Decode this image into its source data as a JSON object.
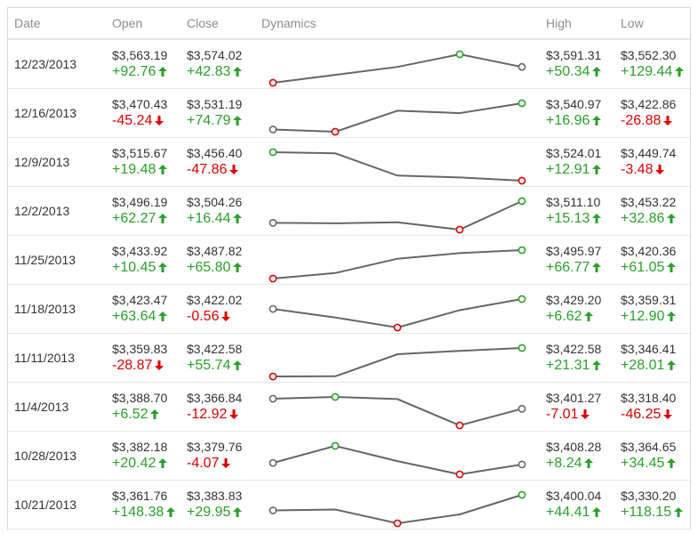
{
  "columns": [
    "Date",
    "Open",
    "Close",
    "Dynamics",
    "High",
    "Low"
  ],
  "colors": {
    "up": "#2aa12a",
    "down": "#e00000",
    "line": "#666666"
  },
  "rows": [
    {
      "date": "12/23/2013",
      "open": {
        "price": "$3,563.19",
        "change": "+92.76",
        "dir": "up"
      },
      "close": {
        "price": "$3,574.02",
        "change": "+42.83",
        "dir": "up"
      },
      "high": {
        "price": "$3,591.31",
        "change": "+50.34",
        "dir": "up"
      },
      "low": {
        "price": "$3,552.30",
        "change": "+129.44",
        "dir": "up"
      },
      "dynamics": [
        3552.3,
        3563.19,
        3574.02,
        3591.31,
        3574.02
      ]
    },
    {
      "date": "12/16/2013",
      "open": {
        "price": "$3,470.43",
        "change": "-45.24",
        "dir": "down"
      },
      "close": {
        "price": "$3,531.19",
        "change": "+74.79",
        "dir": "up"
      },
      "high": {
        "price": "$3,540.97",
        "change": "+16.96",
        "dir": "up"
      },
      "low": {
        "price": "$3,422.86",
        "change": "-26.88",
        "dir": "down"
      },
      "dynamics": [
        3432,
        3422.86,
        3510,
        3500,
        3540.97
      ]
    },
    {
      "date": "12/9/2013",
      "open": {
        "price": "$3,515.67",
        "change": "+19.48",
        "dir": "up"
      },
      "close": {
        "price": "$3,456.40",
        "change": "-47.86",
        "dir": "down"
      },
      "high": {
        "price": "$3,524.01",
        "change": "+12.91",
        "dir": "up"
      },
      "low": {
        "price": "$3,449.74",
        "change": "-3.48",
        "dir": "down"
      },
      "dynamics": [
        3524.01,
        3521,
        3463,
        3458,
        3449.74
      ]
    },
    {
      "date": "12/2/2013",
      "open": {
        "price": "$3,496.19",
        "change": "+62.27",
        "dir": "up"
      },
      "close": {
        "price": "$3,504.26",
        "change": "+16.44",
        "dir": "up"
      },
      "high": {
        "price": "$3,511.10",
        "change": "+15.13",
        "dir": "up"
      },
      "low": {
        "price": "$3,453.22",
        "change": "+32.86",
        "dir": "up"
      },
      "dynamics": [
        3467,
        3466,
        3468,
        3453.22,
        3511.1
      ]
    },
    {
      "date": "11/25/2013",
      "open": {
        "price": "$3,433.92",
        "change": "+10.45",
        "dir": "up"
      },
      "close": {
        "price": "$3,487.82",
        "change": "+65.80",
        "dir": "up"
      },
      "high": {
        "price": "$3,495.97",
        "change": "+66.77",
        "dir": "up"
      },
      "low": {
        "price": "$3,420.36",
        "change": "+61.05",
        "dir": "up"
      },
      "dynamics": [
        3420.36,
        3435,
        3473,
        3488,
        3495.97
      ]
    },
    {
      "date": "11/18/2013",
      "open": {
        "price": "$3,423.47",
        "change": "+63.64",
        "dir": "up"
      },
      "close": {
        "price": "$3,422.02",
        "change": "-0.56",
        "dir": "down"
      },
      "high": {
        "price": "$3,429.20",
        "change": "+6.62",
        "dir": "up"
      },
      "low": {
        "price": "$3,359.31",
        "change": "+12.90",
        "dir": "up"
      },
      "dynamics": [
        3405,
        3384,
        3359.31,
        3402,
        3429.2
      ]
    },
    {
      "date": "11/11/2013",
      "open": {
        "price": "$3,359.83",
        "change": "-28.87",
        "dir": "down"
      },
      "close": {
        "price": "$3,422.58",
        "change": "+55.74",
        "dir": "up"
      },
      "high": {
        "price": "$3,422.58",
        "change": "+21.31",
        "dir": "up"
      },
      "low": {
        "price": "$3,346.41",
        "change": "+28.01",
        "dir": "up"
      },
      "dynamics": [
        3346.41,
        3347,
        3406,
        3415,
        3422.58
      ]
    },
    {
      "date": "11/4/2013",
      "open": {
        "price": "$3,388.70",
        "change": "+6.52",
        "dir": "up"
      },
      "close": {
        "price": "$3,366.84",
        "change": "-12.92",
        "dir": "down"
      },
      "high": {
        "price": "$3,401.27",
        "change": "-7.01",
        "dir": "down"
      },
      "low": {
        "price": "$3,318.40",
        "change": "-46.25",
        "dir": "down"
      },
      "dynamics": [
        3396,
        3401.27,
        3395,
        3318.4,
        3366.84
      ]
    },
    {
      "date": "10/28/2013",
      "open": {
        "price": "$3,382.18",
        "change": "+20.42",
        "dir": "up"
      },
      "close": {
        "price": "$3,379.76",
        "change": "-4.07",
        "dir": "down"
      },
      "high": {
        "price": "$3,408.28",
        "change": "+8.24",
        "dir": "up"
      },
      "low": {
        "price": "$3,364.65",
        "change": "+34.45",
        "dir": "up"
      },
      "dynamics": [
        3382.18,
        3408.28,
        3385,
        3364.65,
        3379.76
      ]
    },
    {
      "date": "10/21/2013",
      "open": {
        "price": "$3,361.76",
        "change": "+148.38",
        "dir": "up"
      },
      "close": {
        "price": "$3,383.83",
        "change": "+29.95",
        "dir": "up"
      },
      "high": {
        "price": "$3,400.04",
        "change": "+44.41",
        "dir": "up"
      },
      "low": {
        "price": "$3,330.20",
        "change": "+118.15",
        "dir": "up"
      },
      "dynamics": [
        3361.76,
        3364,
        3330.2,
        3352,
        3400.04
      ]
    }
  ]
}
